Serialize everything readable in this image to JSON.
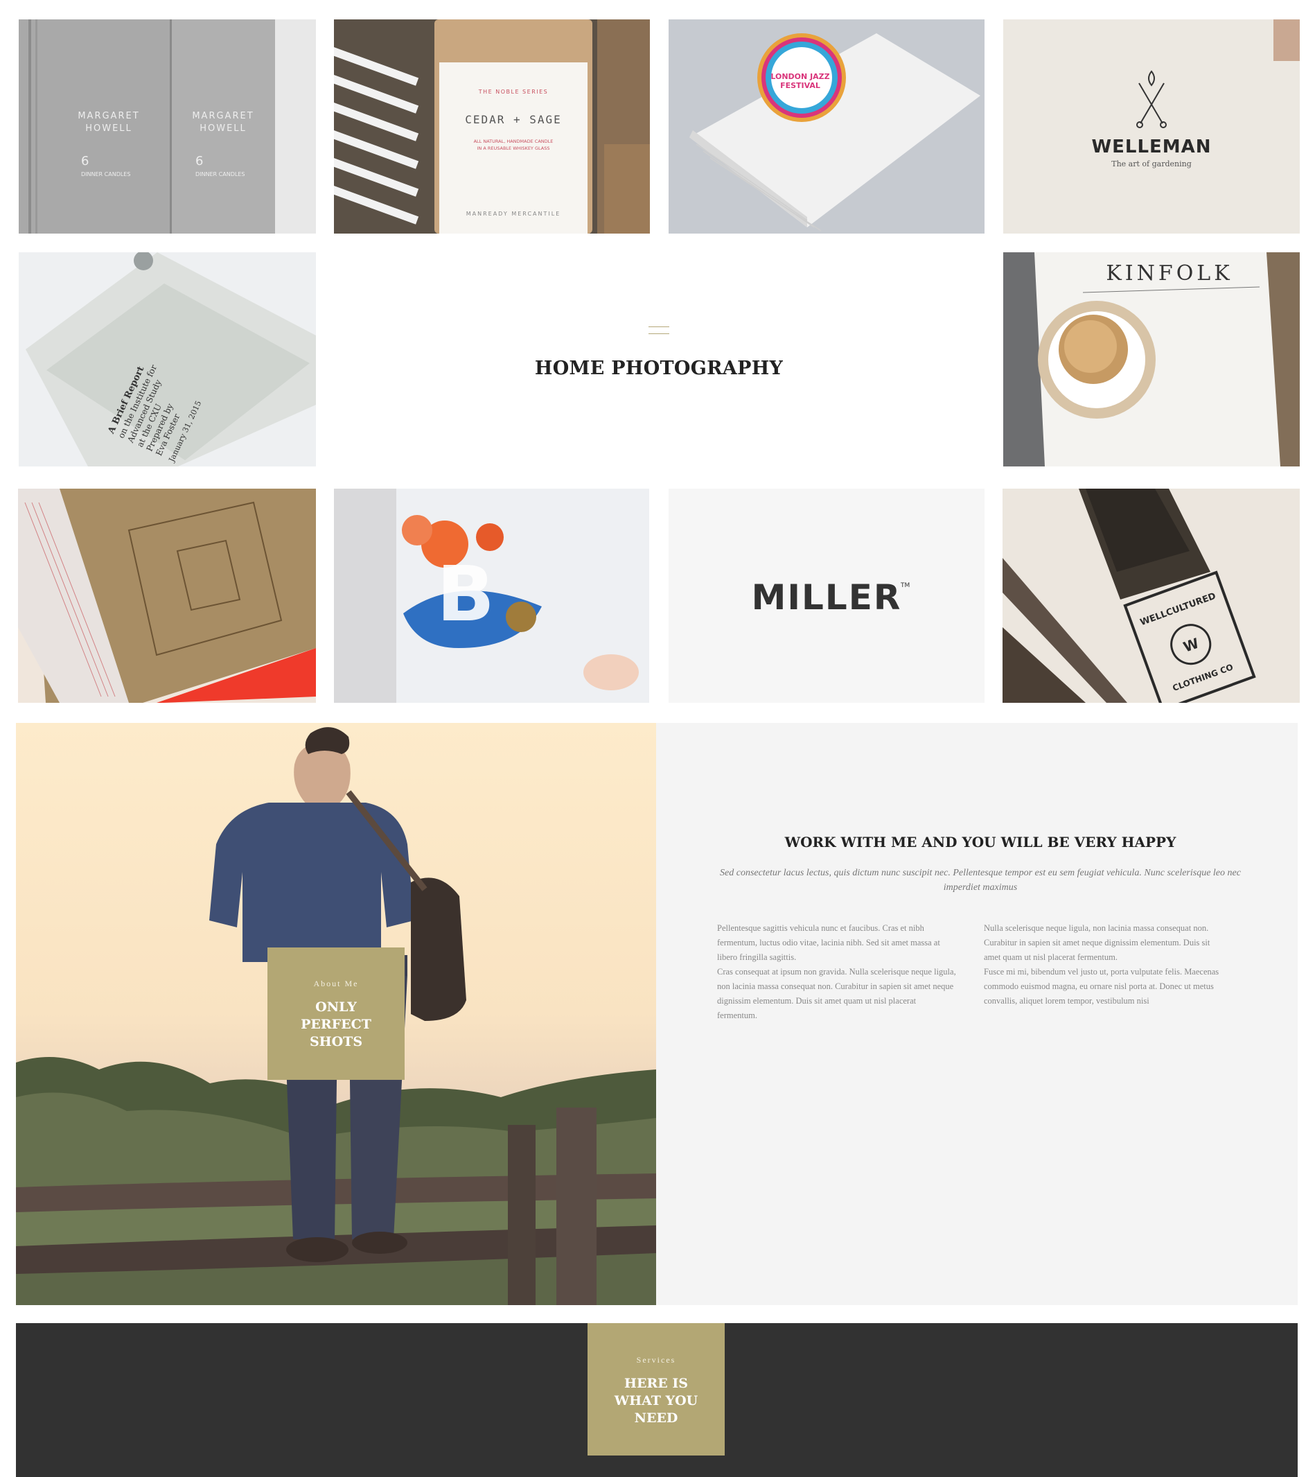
{
  "portfolio": {
    "tiles": [
      {
        "name": "portfolio-tile-margaret-howell",
        "logo": "MARGARET HOWELL",
        "sub": "6 DINNER CANDLES"
      },
      {
        "name": "portfolio-tile-cedar-sage",
        "label": "THE NOBLE SERIES",
        "logo": "CEDAR + SAGE",
        "sub": "ALL NATURAL, HANDMADE CANDLE IN A REUSABLE WHISKEY GLASS",
        "footer": "MANREADY MERCANTILE"
      },
      {
        "name": "portfolio-tile-london-jazz-festival",
        "logo": "LONDON JAZZ FESTIVAL"
      },
      {
        "name": "portfolio-tile-welleman",
        "logo": "WELLEMAN",
        "sub": "The art of gardening"
      },
      {
        "name": "portfolio-tile-brief-report",
        "logo": "A Brief Report on the Institute for Advanced Study at the CXU Prepared by Eva Foster",
        "sub": "January 31, 2015"
      },
      {
        "name": "portfolio-tile-kinfolk",
        "logo": "KINFOLK"
      },
      {
        "name": "portfolio-tile-book-print"
      },
      {
        "name": "portfolio-tile-b-illustration"
      },
      {
        "name": "portfolio-tile-miller",
        "logo": "MILLER"
      },
      {
        "name": "portfolio-tile-wellcultured",
        "logo": "WELLCULTURED",
        "sub": "CLOTHING CO"
      }
    ],
    "center_title": "HOME PHOTOGRAPHY"
  },
  "about": {
    "kicker": "About Me",
    "title": "ONLY PERFECT SHOTS",
    "heading": "WORK WITH ME AND YOU WILL BE VERY HAPPY",
    "lead": "Sed consectetur lacus lectus, quis dictum nunc suscipit nec. Pellentesque tempor est eu sem feugiat vehicula. Nunc scelerisque leo nec imperdiet maximus",
    "col1": [
      "Pellentesque sagittis vehicula nunc et faucibus. Cras et nibh fermentum, luctus odio vitae, lacinia nibh. Sed sit amet massa at libero fringilla sagittis.",
      "Cras consequat at ipsum non gravida. Nulla scelerisque neque ligula, non lacinia massa consequat non. Curabitur in sapien sit amet neque dignissim elementum. Duis sit amet quam ut nisl placerat fermentum."
    ],
    "col2": [
      "Nulla scelerisque neque ligula, non lacinia massa consequat non. Curabitur in sapien sit amet neque dignissim elementum. Duis sit amet quam ut nisl placerat fermentum.",
      "Fusce mi mi, bibendum vel justo ut, porta vulputate felis. Maecenas commodo euismod magna, eu ornare nisl porta at. Donec ut metus convallis, aliquet lorem tempor, vestibulum nisi"
    ]
  },
  "services": {
    "kicker": "Services",
    "title": "HERE IS WHAT YOU NEED"
  },
  "colors": {
    "accent": "#b3a774",
    "dark": "#323232",
    "light_panel": "#f4f4f4"
  }
}
